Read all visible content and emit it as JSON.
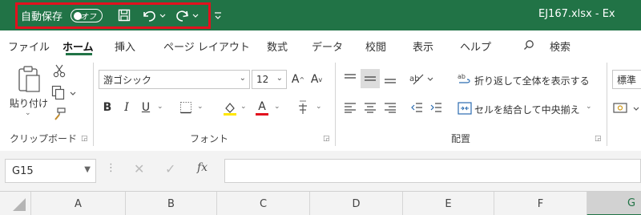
{
  "titlebar": {
    "autosave_label": "自動保存",
    "autosave_state": "オフ",
    "filename": "EJ167.xlsx  -  Ex",
    "bg_color": "#217346",
    "highlight_color": "#e2111e"
  },
  "tabs": [
    {
      "label": "ファイル"
    },
    {
      "label": "ホーム"
    },
    {
      "label": "挿入"
    },
    {
      "label": "ページ レイアウト"
    },
    {
      "label": "数式"
    },
    {
      "label": "データ"
    },
    {
      "label": "校閲"
    },
    {
      "label": "表示"
    },
    {
      "label": "ヘルプ"
    },
    {
      "label": "検索"
    }
  ],
  "ribbon": {
    "clipboard": {
      "paste_label": "貼り付け",
      "group_label": "クリップボード"
    },
    "font": {
      "font_name": "游ゴシック",
      "font_size": "12",
      "group_label": "フォント",
      "bold": "B",
      "italic": "I",
      "underline": "U",
      "font_color_glyph": "A",
      "grow": "A",
      "shrink": "A"
    },
    "alignment": {
      "wrap_label": "折り返して全体を表示する",
      "merge_label": "セルを結合して中央揃え",
      "group_label": "配置"
    },
    "number": {
      "format_label": "標準"
    }
  },
  "formula_bar": {
    "name_box": "G15",
    "fx_label": "fx",
    "cancel_glyph": "✕",
    "enter_glyph": "✓"
  },
  "columns": [
    {
      "label": "A"
    },
    {
      "label": "B"
    },
    {
      "label": "C"
    },
    {
      "label": "D"
    },
    {
      "label": "E"
    },
    {
      "label": "F"
    },
    {
      "label": "G"
    }
  ]
}
